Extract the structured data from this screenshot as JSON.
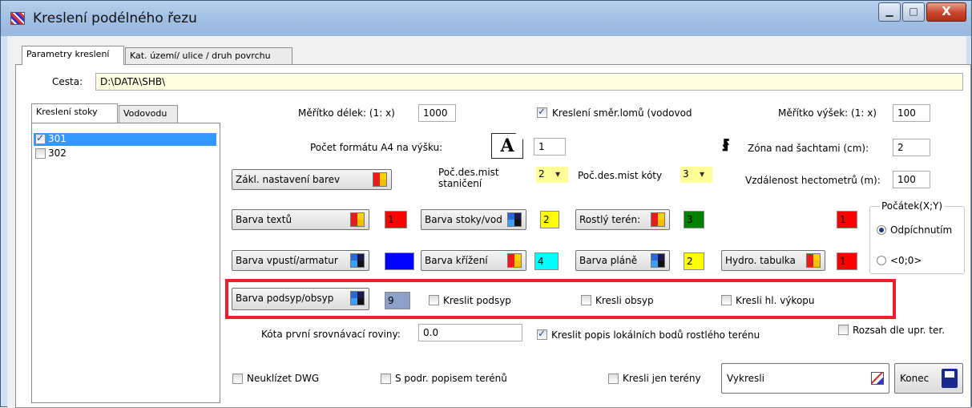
{
  "window": {
    "title": "Kreslení podélného řezu",
    "close_label": "X"
  },
  "tabs": {
    "main": [
      "Parametry kreslení",
      "Kat. území/ ulice / druh povrchu"
    ],
    "left": [
      "Kreslení  stoky",
      "Vodovodu"
    ]
  },
  "path": {
    "label": "Cesta:",
    "value": "D:\\DATA\\SHB\\"
  },
  "list": {
    "items": [
      {
        "label": "301",
        "checked": true
      },
      {
        "label": "302",
        "checked": false
      }
    ]
  },
  "row1": {
    "meritko_delek_label": "Měřítko délek: (1:  x)",
    "meritko_delek_value": "1000",
    "kresleni_smer_label": "Kreslení směr.lomů (vodovod",
    "meritko_vysek_label": "Měřítko výšek: (1:  x)",
    "meritko_vysek_value": "100"
  },
  "row2": {
    "pocet_formatu_label": "Počet formátu A4 na výšku:",
    "pocet_formatu_value": "1",
    "a4_glyph": "A",
    "zona_label": "Zóna nad šachtami (cm):",
    "zona_value": "2"
  },
  "row3": {
    "zakl_button": "Zákl. nastavení barev",
    "pocdes_stan_label_1": "Poč.des.mist",
    "pocdes_stan_label_2": "staničení",
    "pocdes_stan_value": "2",
    "pocdes_koty_label": "Poč.des.mist kóty",
    "pocdes_koty_value": "3",
    "vzdalenost_label": "Vzdálenost hectometrů (m):",
    "vzdalenost_value": "100"
  },
  "colors": {
    "barva_textu": {
      "label": "Barva textů",
      "value": "1",
      "color": "#ff0000"
    },
    "barva_stoky": {
      "label": "Barva stoky/vod",
      "value": "2",
      "color": "#ffff00"
    },
    "rostly_teren": {
      "label": "Rostlý terén:",
      "value": "3",
      "color": "#008000"
    },
    "extra_red": {
      "value": "1",
      "color": "#ff0000"
    },
    "barva_vpusti": {
      "label": "Barva vpustí/armatur",
      "value": "5",
      "color": "#0000ff"
    },
    "barva_krizeni": {
      "label": "Barva křížení",
      "value": "4",
      "color": "#00ffff"
    },
    "barva_plane": {
      "label": "Barva pláně",
      "value": "2",
      "color": "#ffff00"
    },
    "hydro_tabulka": {
      "label": "Hydro. tabulka",
      "value": "1",
      "color": "#ff0000"
    },
    "barva_podsyp": {
      "label": "Barva podsyp/obsyp",
      "value": "9",
      "color": "#8ca0c8"
    }
  },
  "pocatek": {
    "title": "Počátek(X;Y)",
    "options": [
      "Odpíchnutím",
      "<0;0>"
    ]
  },
  "checks": {
    "kreslit_podsyp": "Kreslit podsyp",
    "kresli_obsyp": "Kresli obsyp",
    "kresli_hl_vykopu": "Kresli hl. výkopu",
    "kreslit_popis": "Kreslit popis lokálních bodů rostlého terénu",
    "rozsah": "Rozsah dle upr. ter.",
    "neuklizet": "Neuklízet DWG",
    "s_podr": "S podr. popisem terénů",
    "kresli_jen": "Kresli jen terény"
  },
  "kota": {
    "label": "Kóta první srovnávací roviny:",
    "value": "0.0"
  },
  "actions": {
    "vykresli": "Vykresli",
    "konec": "Konec"
  }
}
